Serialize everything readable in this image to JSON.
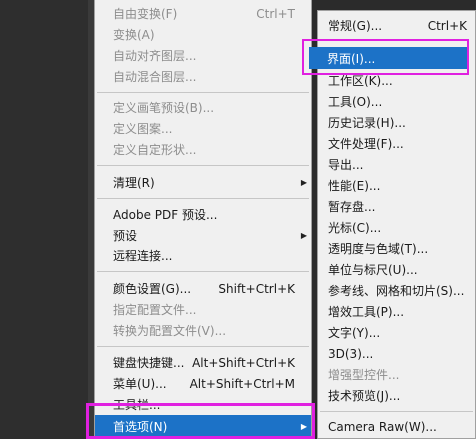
{
  "main_menu": {
    "items": [
      {
        "label": "自由变换(F)",
        "shortcut": "Ctrl+T",
        "disabled": true
      },
      {
        "label": "变换(A)",
        "disabled": true,
        "submenu": true
      },
      {
        "label": "自动对齐图层...",
        "disabled": true
      },
      {
        "label": "自动混合图层...",
        "disabled": true
      },
      {
        "label": "定义画笔预设(B)...",
        "disabled": true
      },
      {
        "label": "定义图案...",
        "disabled": true
      },
      {
        "label": "定义自定形状...",
        "disabled": true
      },
      {
        "label": "清理(R)",
        "disabled": false,
        "submenu": true
      },
      {
        "label": "Adobe PDF 预设...",
        "disabled": false
      },
      {
        "label": "预设",
        "disabled": false,
        "submenu": true
      },
      {
        "label": "远程连接...",
        "disabled": false
      },
      {
        "label": "颜色设置(G)...",
        "shortcut": "Shift+Ctrl+K",
        "disabled": false
      },
      {
        "label": "指定配置文件...",
        "disabled": true
      },
      {
        "label": "转换为配置文件(V)...",
        "disabled": true
      },
      {
        "label": "键盘快捷键...",
        "shortcut": "Alt+Shift+Ctrl+K",
        "disabled": false
      },
      {
        "label": "菜单(U)...",
        "shortcut": "Alt+Shift+Ctrl+M",
        "disabled": false
      },
      {
        "label": "工具栏...",
        "disabled": false
      },
      {
        "label": "首选项(N)",
        "disabled": false,
        "submenu": true,
        "highlighted": true
      }
    ]
  },
  "sub_menu": {
    "items": [
      {
        "label": "常规(G)...",
        "shortcut": "Ctrl+K",
        "disabled": false
      },
      {
        "label": "界面(I)...",
        "disabled": false,
        "highlighted": true
      },
      {
        "label": "工作区(K)...",
        "disabled": false
      },
      {
        "label": "工具(O)...",
        "disabled": false
      },
      {
        "label": "历史记录(H)...",
        "disabled": false
      },
      {
        "label": "文件处理(F)...",
        "disabled": false
      },
      {
        "label": "导出...",
        "disabled": false
      },
      {
        "label": "性能(E)...",
        "disabled": false
      },
      {
        "label": "暂存盘...",
        "disabled": false
      },
      {
        "label": "光标(C)...",
        "disabled": false
      },
      {
        "label": "透明度与色域(T)...",
        "disabled": false
      },
      {
        "label": "单位与标尺(U)...",
        "disabled": false
      },
      {
        "label": "参考线、网格和切片(S)...",
        "disabled": false
      },
      {
        "label": "增效工具(P)...",
        "disabled": false
      },
      {
        "label": "文字(Y)...",
        "disabled": false
      },
      {
        "label": "3D(3)...",
        "disabled": false
      },
      {
        "label": "增强型控件...",
        "disabled": true
      },
      {
        "label": "技术预览(J)...",
        "disabled": false
      },
      {
        "label": "Camera Raw(W)...",
        "disabled": false
      }
    ]
  },
  "arrow_glyph": "▶",
  "colors": {
    "highlight": "#1c72c7",
    "annotation": "#e020e0"
  }
}
